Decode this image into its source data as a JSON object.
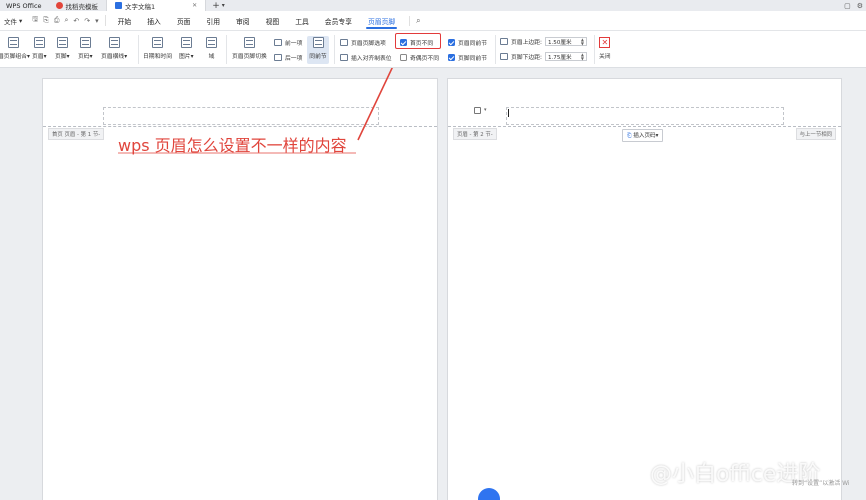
{
  "titlebar": {
    "app_name": "WPS Office",
    "tabs": [
      {
        "label": "找稻壳模板",
        "icon": "wps-red-icon",
        "color": "#e2453a"
      },
      {
        "label": "文字文稿1",
        "icon": "wps-writer-icon",
        "color": "#2b6fe0"
      }
    ],
    "add_tab": "+",
    "add_tab_more": "▾"
  },
  "menubar": {
    "file": "文件",
    "file_arrow": "▾",
    "items": [
      "开始",
      "插入",
      "页面",
      "引用",
      "审阅",
      "视图",
      "工具",
      "会员专享",
      "页眉页脚"
    ],
    "active_index": 8
  },
  "ribbon": {
    "left_group": [
      {
        "label": "眉页脚组合▾"
      },
      {
        "label": "页眉▾"
      },
      {
        "label": "页脚▾"
      },
      {
        "label": "页码▾"
      },
      {
        "label": "页眉横线▾"
      }
    ],
    "insert_group": [
      {
        "label": "日期和时间"
      },
      {
        "label": "图片▾"
      },
      {
        "label": "域"
      }
    ],
    "switch": {
      "label": "页眉页脚切换"
    },
    "nav": {
      "prev": "前一项",
      "next": "后一项"
    },
    "link_prev": {
      "label": "同前节"
    },
    "options": {
      "hf_options": "页眉页脚选项",
      "insert_tab": "插入对齐制表位",
      "first_page_diff": "首页不同",
      "odd_even_diff": "奇偶页不同",
      "header_same_prev": "页眉同前节",
      "footer_same_prev": "页脚同前节"
    },
    "margins": {
      "header_label": "页眉上边距:",
      "header_value": "1.50厘米",
      "footer_label": "页脚下边距:",
      "footer_value": "1.75厘米"
    },
    "close": {
      "label": "关闭",
      "color": "#e23b3b"
    }
  },
  "document": {
    "page1_header_label": "首页 页眉 - 第 1 节-",
    "page2_header_label": "页眉 - 第 2 节-",
    "page2_same_prev": "与上一节相同",
    "insert_page_number": "插入页码▾",
    "ico_arrow": "▾"
  },
  "annotation": {
    "text": "wps 页眉怎么设置不一样的内容",
    "color": "#e0453c"
  },
  "watermark": {
    "text": "@小白office进阶",
    "sub": "转到“设置”以激活 Wi"
  }
}
